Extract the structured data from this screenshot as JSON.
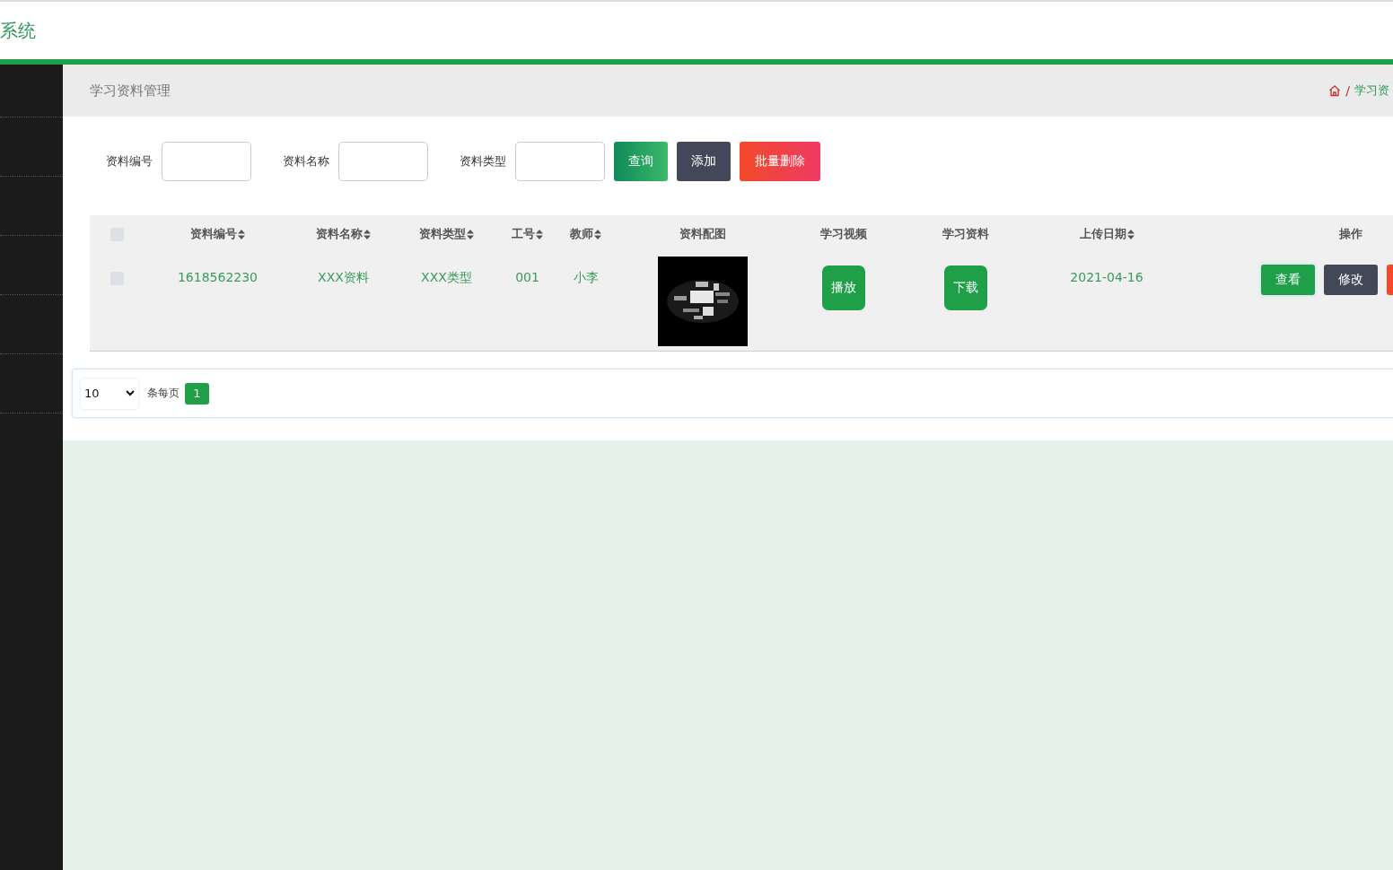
{
  "header": {
    "title": "系统"
  },
  "breadcrumb": {
    "page_title": "学习资料管理",
    "separator": "/",
    "trail": "学习资"
  },
  "search": {
    "fields": [
      {
        "label": "资料编号"
      },
      {
        "label": "资料名称"
      },
      {
        "label": "资料类型"
      }
    ],
    "buttons": [
      {
        "label": "查询",
        "kind": "search"
      },
      {
        "label": "添加",
        "kind": "add"
      },
      {
        "label": "批量删除",
        "kind": "delete"
      }
    ]
  },
  "table": {
    "select_all": {
      "checked": false
    },
    "columns": [
      {
        "label": "资料编号",
        "sortable": true,
        "kind": "text"
      },
      {
        "label": "资料名称",
        "sortable": true,
        "kind": "text"
      },
      {
        "label": "资料类型",
        "sortable": true,
        "kind": "text"
      },
      {
        "label": "工号",
        "sortable": true,
        "kind": "text"
      },
      {
        "label": "教师",
        "sortable": true,
        "kind": "text"
      },
      {
        "label": "资料配图",
        "sortable": false,
        "kind": "picture"
      },
      {
        "label": "学习视频",
        "sortable": false,
        "kind": "button"
      },
      {
        "label": "学习资料",
        "sortable": false,
        "kind": "button"
      },
      {
        "label": "上传日期",
        "sortable": true,
        "kind": "text"
      },
      {
        "label": "操作",
        "sortable": false,
        "kind": "actions"
      }
    ],
    "rows": [
      {
        "checked": false,
        "cells": [
          {
            "text": "1618562230"
          },
          {
            "text": "XXX资料"
          },
          {
            "text": "XXX类型"
          },
          {
            "text": "001"
          },
          {
            "text": "小李"
          },
          {
            "kind": "picture"
          },
          {
            "text": "播放"
          },
          {
            "text": "下载"
          },
          {
            "text": "2021-04-16"
          },
          {
            "actions": [
              {
                "label": "查看",
                "kind": "view"
              },
              {
                "label": "修改",
                "kind": "edit"
              },
              {
                "kind": "delete"
              }
            ]
          }
        ]
      }
    ]
  },
  "pagination": {
    "page_size": "10",
    "page_size_label": "条每页",
    "pages": [
      {
        "label": "1",
        "selected": true
      }
    ]
  }
}
